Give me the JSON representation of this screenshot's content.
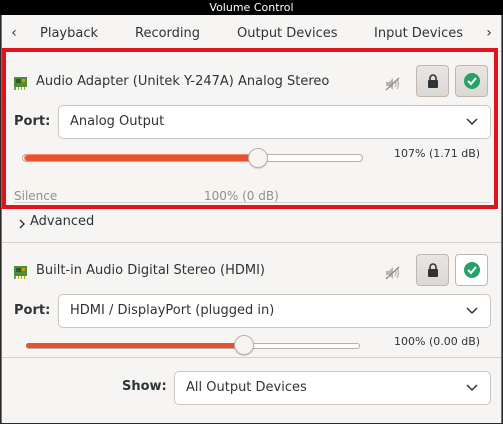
{
  "window": {
    "title": "Volume Control"
  },
  "tabs": [
    {
      "label": "Playback"
    },
    {
      "label": "Recording"
    },
    {
      "label": "Output Devices"
    },
    {
      "label": "Input Devices"
    }
  ],
  "devices": [
    {
      "name": "Audio Adapter (Unitek Y-247A) Analog Stereo",
      "port_label": "Port:",
      "port_value": "Analog Output",
      "volume_readout": "107% (1.71 dB)",
      "volume_percent": 107,
      "scale_min_label": "Silence",
      "scale_mid_label": "100% (0 dB)",
      "locked": true,
      "default": true
    },
    {
      "name": "Built-in Audio Digital Stereo (HDMI)",
      "port_label": "Port:",
      "port_value": "HDMI / DisplayPort (plugged in)",
      "volume_readout": "100% (0.00 dB)",
      "volume_percent": 100,
      "locked": true,
      "default": false
    }
  ],
  "advanced": {
    "label": "Advanced"
  },
  "show": {
    "label": "Show:",
    "value": "All Output Devices"
  },
  "colors": {
    "accent": "#e5522b",
    "highlight": "#e1141d",
    "check": "#26a269"
  }
}
